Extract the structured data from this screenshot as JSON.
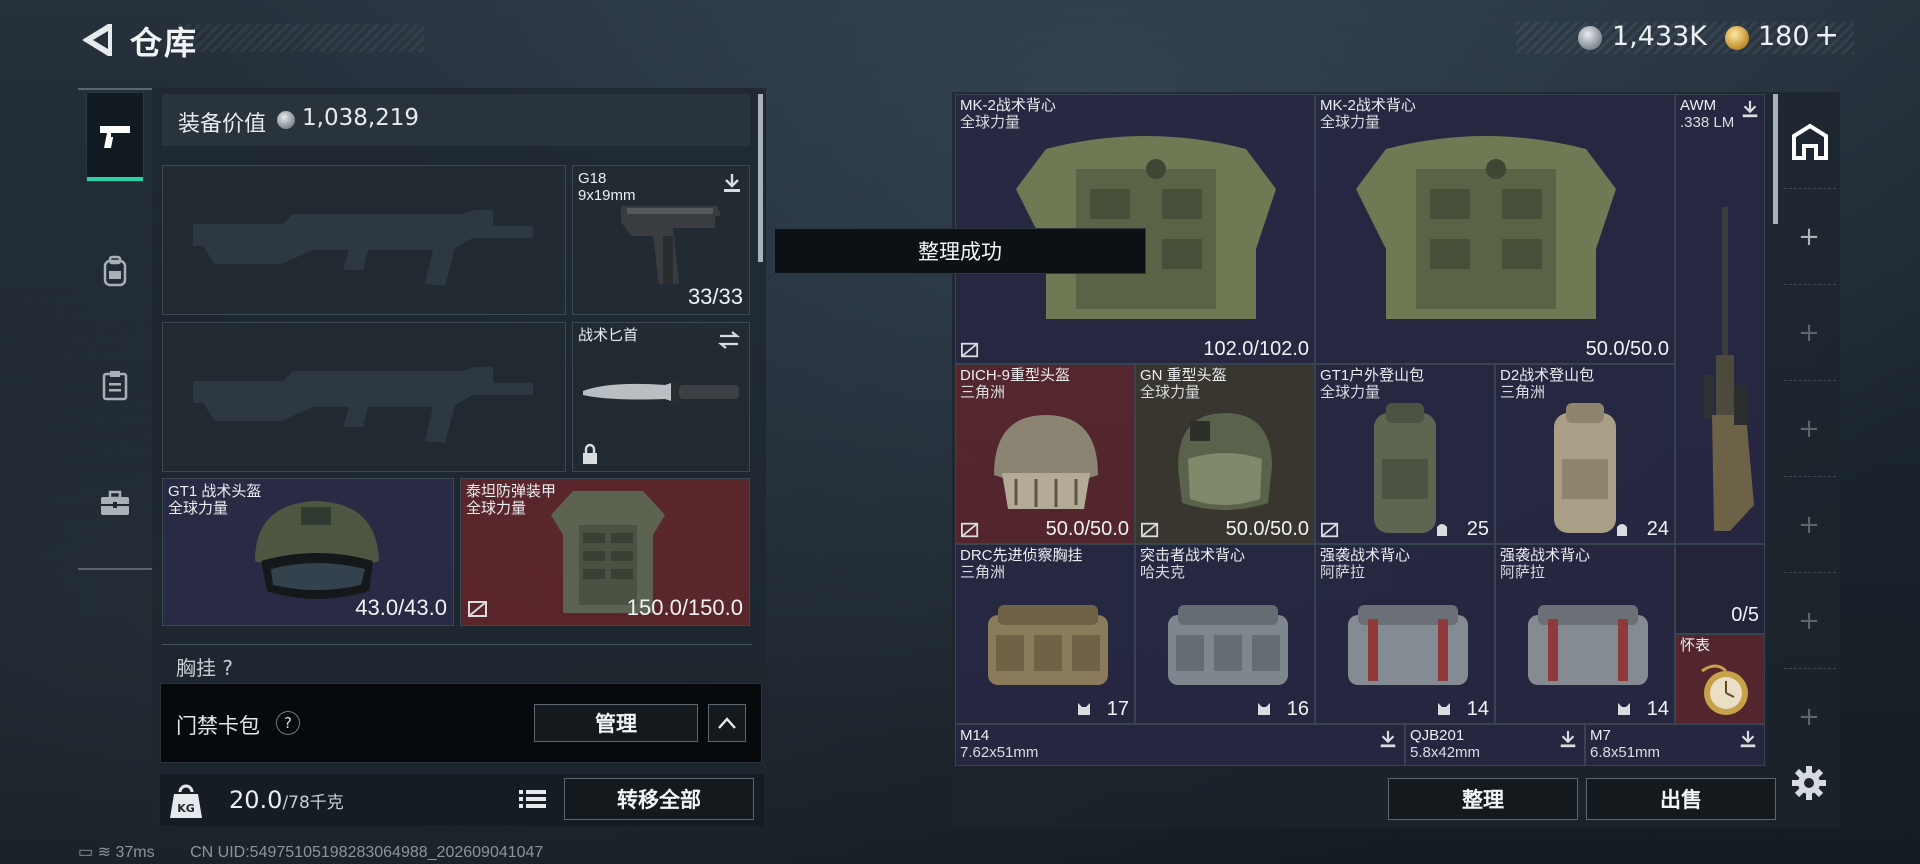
{
  "header": {
    "title": "仓库",
    "back_icon": "chevron-left-icon",
    "currency_a": "1,433K",
    "currency_b": "180",
    "currency_b_add": "+"
  },
  "left_nav": {
    "items": [
      {
        "icon": "pistol-icon",
        "active": true
      },
      {
        "icon": "backpack-icon",
        "active": false
      },
      {
        "icon": "clipboard-icon",
        "active": false
      },
      {
        "icon": "toolbox-icon",
        "active": false
      }
    ]
  },
  "equipment": {
    "value_label": "装备价值",
    "value": "1,038,219",
    "pistol": {
      "name": "G18",
      "caliber": "9x19mm",
      "ammo": "33/33"
    },
    "melee": {
      "name": "战术匕首"
    },
    "helmet": {
      "name": "GT1 战术头盔",
      "faction": "全球力量",
      "durability": "43.0/43.0"
    },
    "armor": {
      "name": "泰坦防弹装甲",
      "faction": "全球力量",
      "durability": "150.0/150.0"
    },
    "chest_label": "胸挂",
    "chest_help": "?",
    "keycard_label": "门禁卡包",
    "keycard_help": "?",
    "manage_label": "管理",
    "weight": "20.0",
    "weight_max": "/78千克",
    "weight_icon_text": "KG",
    "transfer_label": "转移全部"
  },
  "toast": "整理成功",
  "stash": {
    "items": [
      {
        "name": "MK-2战术背心",
        "sub": "全球力量",
        "value": "102.0/102.0",
        "style": "normal"
      },
      {
        "name": "MK-2战术背心",
        "sub": "全球力量",
        "value": "50.0/50.0",
        "style": "normal"
      },
      {
        "name": "AWM",
        "sub": ".338 LM",
        "value": "",
        "style": "normal"
      },
      {
        "name": "DICH-9重型头盔",
        "sub": "三角洲",
        "value": "50.0/50.0",
        "style": "red"
      },
      {
        "name": "GN 重型头盔",
        "sub": "全球力量",
        "value": "50.0/50.0",
        "style": "normal"
      },
      {
        "name": "GT1户外登山包",
        "sub": "全球力量",
        "value": "25",
        "style": "normal"
      },
      {
        "name": "D2战术登山包",
        "sub": "三角洲",
        "value": "24",
        "style": "normal"
      },
      {
        "name": "DRC先进侦察胸挂",
        "sub": "三角洲",
        "value": "17",
        "style": "normal"
      },
      {
        "name": "突击者战术背心",
        "sub": "哈夫克",
        "value": "16",
        "style": "normal"
      },
      {
        "name": "强袭战术背心",
        "sub": "阿萨拉",
        "value": "14",
        "style": "normal"
      },
      {
        "name": "强袭战术背心",
        "sub": "阿萨拉",
        "value": "14",
        "style": "normal"
      },
      {
        "name": "",
        "sub": "",
        "value": "0/5",
        "style": "normal"
      },
      {
        "name": "怀表",
        "sub": "",
        "value": "",
        "style": "red"
      },
      {
        "name": "M14",
        "sub": "7.62x51mm",
        "value": "",
        "style": "normal"
      },
      {
        "name": "QJB201",
        "sub": "5.8x42mm",
        "value": "",
        "style": "normal"
      },
      {
        "name": "M7",
        "sub": "6.8x51mm",
        "value": "",
        "style": "normal"
      }
    ],
    "sort_label": "整理",
    "sell_label": "出售"
  },
  "status": {
    "ping": "37ms",
    "uid": "CN UID:549751051982830649​88_202609041047"
  },
  "colors": {
    "accent": "#2bd1a2",
    "red_cell": "#6e262a",
    "purple_cell": "#2a2846"
  }
}
